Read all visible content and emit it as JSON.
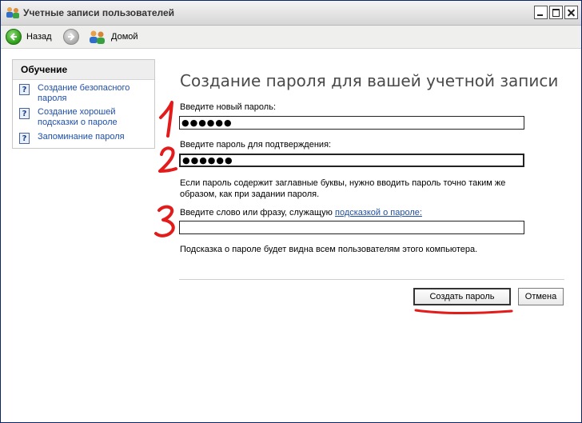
{
  "window": {
    "title": "Учетные записи пользователей"
  },
  "toolbar": {
    "back_label": "Назад",
    "home_label": "Домой"
  },
  "sidebar": {
    "heading": "Обучение",
    "items": [
      {
        "label": "Создание безопасного пароля"
      },
      {
        "label": "Создание хорошей подсказки о пароле"
      },
      {
        "label": "Запоминание пароля"
      }
    ]
  },
  "main": {
    "title": "Создание пароля для вашей учетной записи",
    "new_password_label": "Введите новый пароль:",
    "new_password_value": "●●●●●●",
    "confirm_password_label": "Введите пароль для подтверждения:",
    "confirm_password_value": "●●●●●●",
    "case_note": "Если пароль содержит заглавные буквы, нужно вводить пароль точно таким же образом, как при задании пароля.",
    "hint_label_prefix": "Введите слово или фразу, служащую ",
    "hint_label_link": "подсказкой о пароле:",
    "hint_value": "",
    "hint_note": "Подсказка о пароле будет видна всем пользователям этого компьютера."
  },
  "buttons": {
    "create": "Создать пароль",
    "cancel": "Отмена"
  },
  "annotations": {
    "marks": [
      "1",
      "2",
      "3"
    ],
    "color": "#e31b1b"
  }
}
